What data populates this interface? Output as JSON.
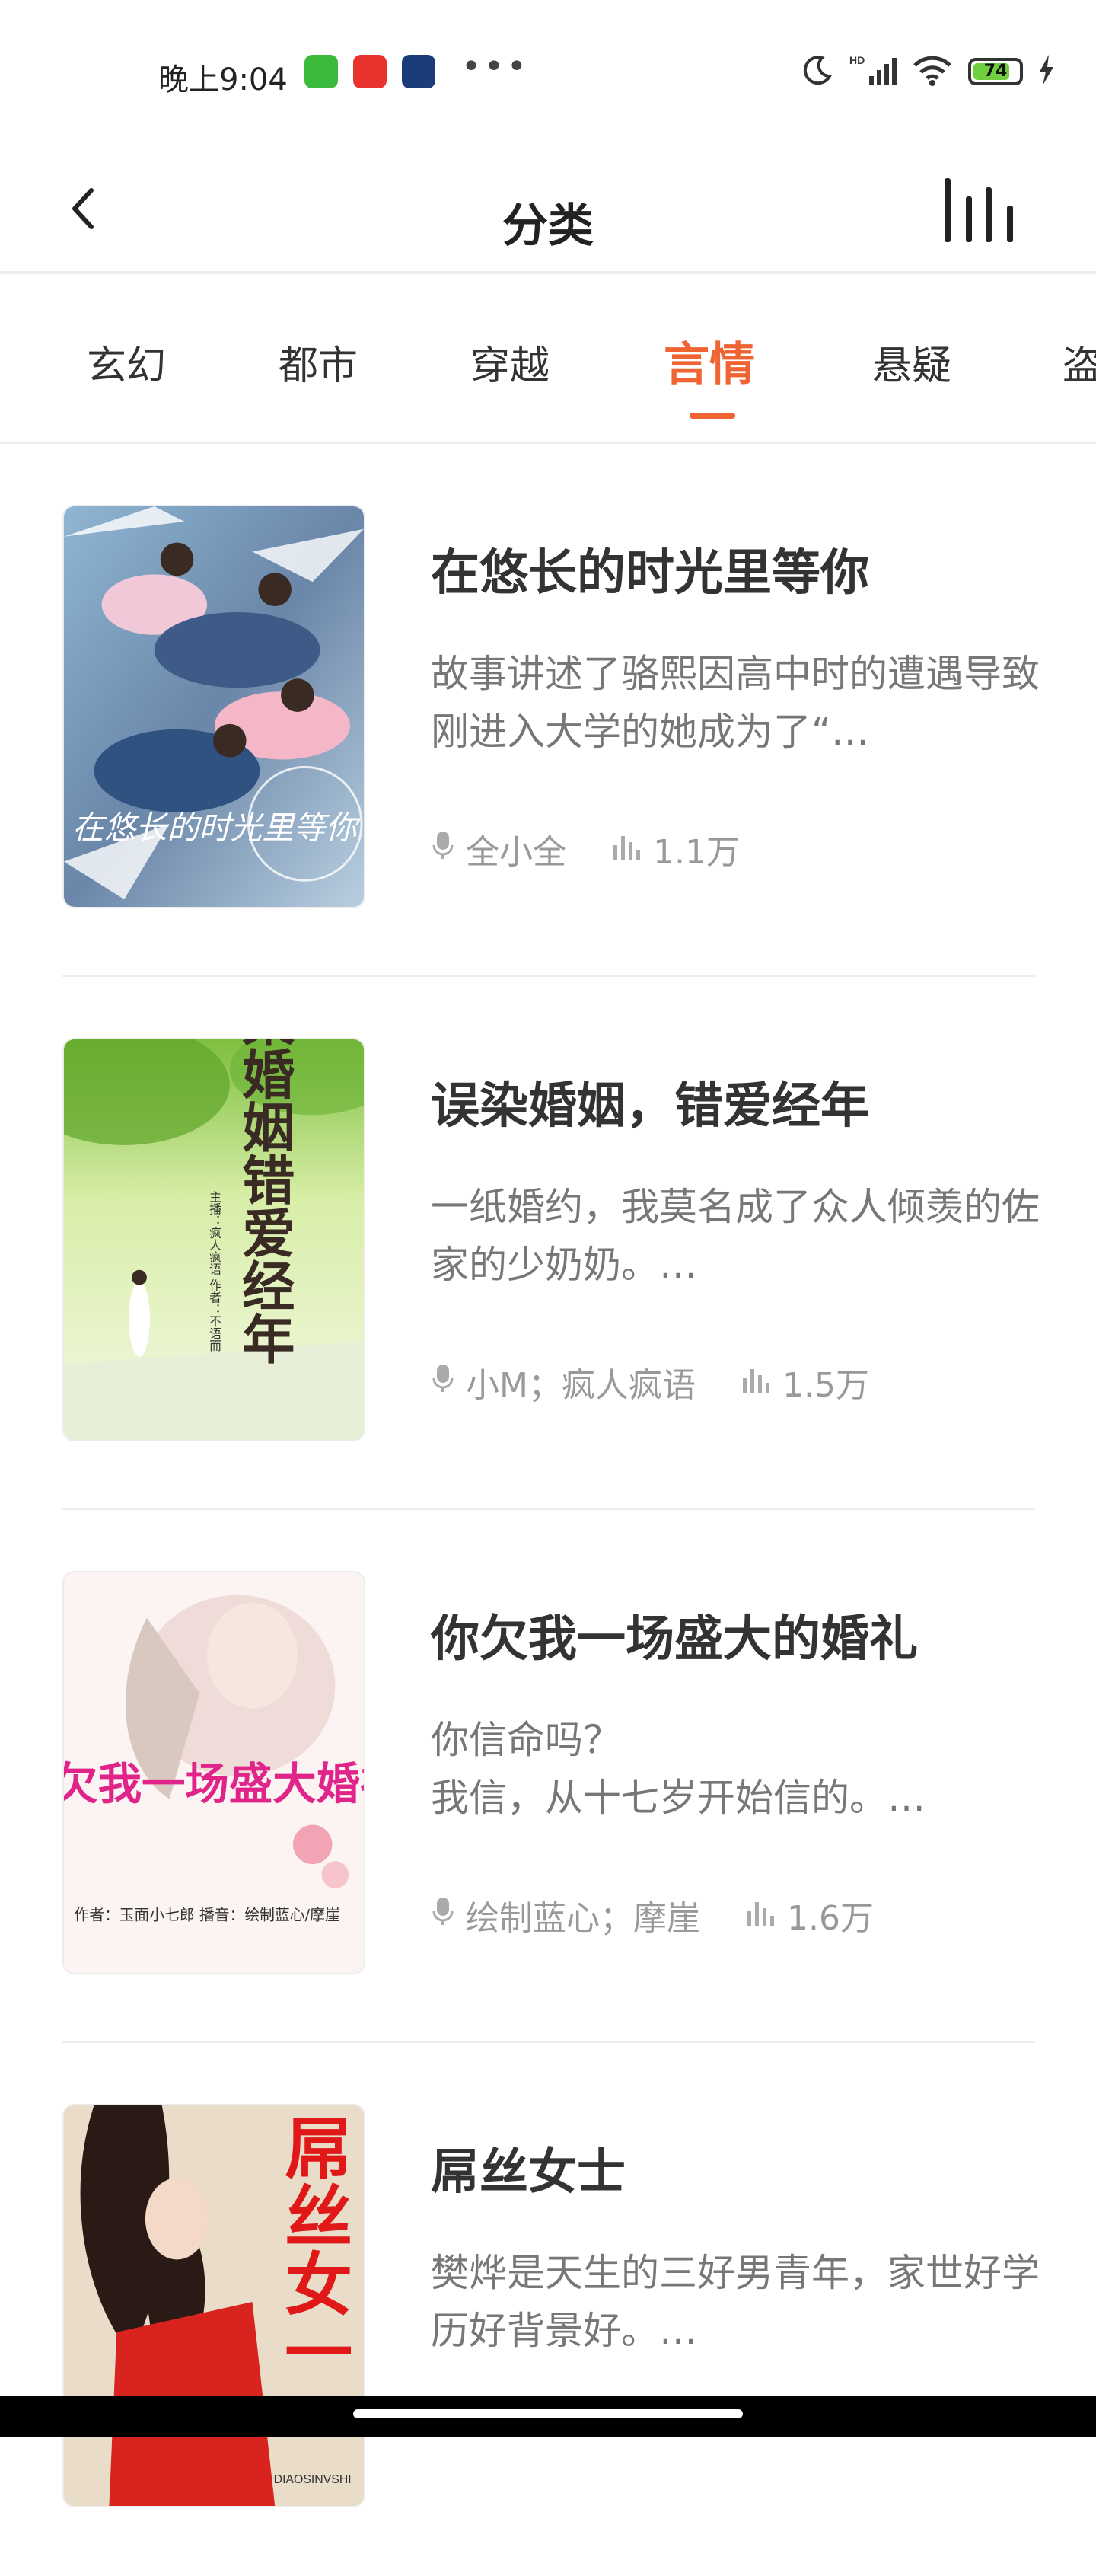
{
  "status_bar": {
    "time": "晚上9:04",
    "battery": "74",
    "colors": {
      "app1": "#3cba3c",
      "app2": "#e8332e",
      "app3": "#1a3c7a"
    },
    "icons": [
      "moon-icon",
      "signal-icon",
      "wifi-icon",
      "battery-icon",
      "charging-icon"
    ]
  },
  "header": {
    "title": "分类",
    "back_icon": "back-chevron-icon",
    "ranking_icon": "ranking-bars-icon"
  },
  "tabs": [
    "玄幻",
    "都市",
    "穿越",
    "言情",
    "悬疑",
    "盗"
  ],
  "active_tab": "言情",
  "accent_color": "#f06434",
  "books": [
    {
      "title": "在悠长的时光里等你",
      "description": "故事讲述了骆熙因高中时的遭遇导致刚进入大学的她成为了“…",
      "author": "全小全",
      "plays": "1.1万"
    },
    {
      "title": "误染婚姻，错爱经年",
      "description": "一纸婚约，我莫名成了众人倾羡的佐家的少奶奶。…",
      "author": "小M；疯人疯语",
      "plays": "1.5万"
    },
    {
      "title": "你欠我一场盛大的婚礼",
      "description": "你信命吗？\n我信，从十七岁开始信的。…",
      "author": "绘制蓝心；摩崖",
      "plays": "1.6万"
    },
    {
      "title": "屌丝女士",
      "description": "樊烨是天生的三好男青年，家世好学历好背景好。…",
      "author": "",
      "plays": ""
    }
  ],
  "covers": [
    {
      "caption": "在悠长的时光里等你",
      "sub": ""
    },
    {
      "caption": "误染婚姻错爱经年",
      "sub": "主播：疯人疯语 作者：不语而"
    },
    {
      "caption": "你欠我一场盛大婚礼",
      "sub": "作者：玉面小七郎 播音：绘制蓝心/摩崖"
    },
    {
      "caption": "屌丝女一",
      "sub": "DIAOSINVSHI"
    }
  ]
}
